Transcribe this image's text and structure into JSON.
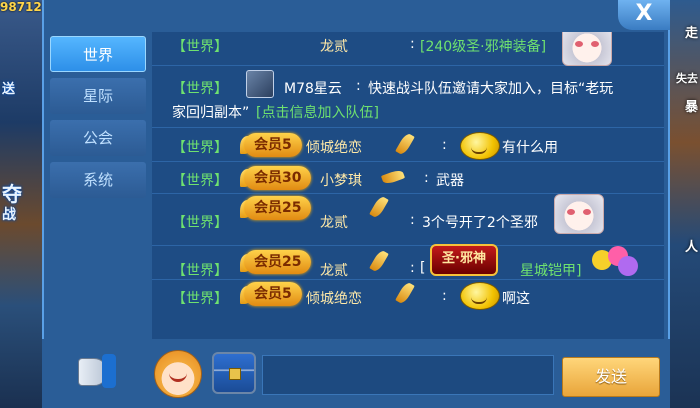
{
  "background": {
    "top_number": "98712",
    "left_texts": [
      "送",
      "夺",
      "战"
    ],
    "right_texts": [
      "走",
      "失去",
      "暴",
      "人"
    ]
  },
  "window": {
    "close_label": "X"
  },
  "tabs": [
    {
      "label": "世界",
      "active": true
    },
    {
      "label": "星际",
      "active": false
    },
    {
      "label": "公会",
      "active": false
    },
    {
      "label": "系统",
      "active": false
    }
  ],
  "messages": [
    {
      "channel": "【世界】",
      "name": "龙贰",
      "colon": ":",
      "text": "[240级圣·邪神装备]"
    },
    {
      "channel": "【世界】",
      "name": "M78星云",
      "colon": ":",
      "text": "快速战斗队伍邀请大家加入，目标“老玩",
      "text2": "家回归副本”",
      "link": "[点击信息加入队伍]"
    },
    {
      "channel": "【世界】",
      "badge": "会员5",
      "name": "倾城绝恋",
      "colon": ":",
      "text": "有什么用"
    },
    {
      "channel": "【世界】",
      "badge": "会员30",
      "name": "小梦琪",
      "colon": ":",
      "text": "武器"
    },
    {
      "channel": "【世界】",
      "badge": "会员25",
      "name": "龙贰",
      "colon": ":",
      "text": "3个号开了2个圣邪"
    },
    {
      "channel": "【世界】",
      "badge": "会员25",
      "name": "龙贰",
      "colon": ":",
      "open": "[",
      "item_badge": "圣·邪神",
      "item_text": "星城铠甲]"
    },
    {
      "channel": "【世界】",
      "badge": "会员5",
      "name": "倾城绝恋",
      "colon": ":",
      "text": "啊这"
    }
  ],
  "composer": {
    "send_label": "发送"
  }
}
